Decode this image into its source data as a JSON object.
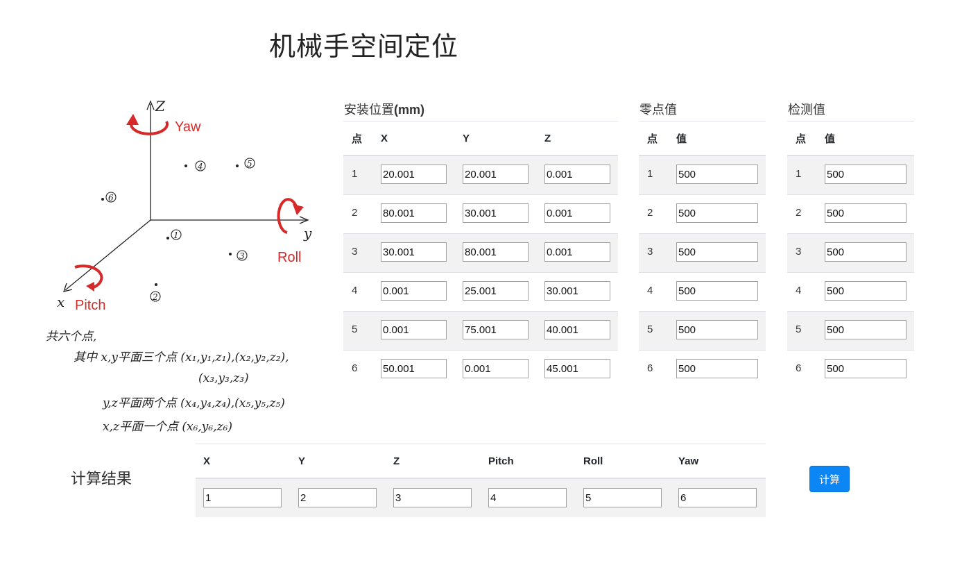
{
  "page_title": "机械手空间定位",
  "diagram": {
    "axis_z": "Z",
    "axis_y": "y",
    "axis_x": "x",
    "label_yaw": "Yaw",
    "label_roll": "Roll",
    "label_pitch": "Pitch",
    "points": [
      "1",
      "2",
      "3",
      "4",
      "5",
      "6"
    ],
    "note_line1": "共六个点,",
    "note_line2": "其中 x,y平面三个点 (x₁,y₁,z₁),(x₂,y₂,z₂),",
    "note_line3": "(x₃,y₃,z₃)",
    "note_line4": "y,z平面两个点 (x₄,y₄,z₄),(x₅,y₅,z₅)",
    "note_line5": "x,z平面一个点 (x₆,y₆,z₆)"
  },
  "position_section": {
    "title": "安装位置",
    "unit": "(mm)",
    "headers": [
      "点",
      "X",
      "Y",
      "Z"
    ],
    "rows": [
      {
        "point": "1",
        "x": "20.001",
        "y": "20.001",
        "z": "0.001"
      },
      {
        "point": "2",
        "x": "80.001",
        "y": "30.001",
        "z": "0.001"
      },
      {
        "point": "3",
        "x": "30.001",
        "y": "80.001",
        "z": "0.001"
      },
      {
        "point": "4",
        "x": "0.001",
        "y": "25.001",
        "z": "30.001"
      },
      {
        "point": "5",
        "x": "0.001",
        "y": "75.001",
        "z": "40.001"
      },
      {
        "point": "6",
        "x": "50.001",
        "y": "0.001",
        "z": "45.001"
      }
    ]
  },
  "zero_section": {
    "title": "零点值",
    "headers": [
      "点",
      "值"
    ],
    "rows": [
      {
        "point": "1",
        "value": "500"
      },
      {
        "point": "2",
        "value": "500"
      },
      {
        "point": "3",
        "value": "500"
      },
      {
        "point": "4",
        "value": "500"
      },
      {
        "point": "5",
        "value": "500"
      },
      {
        "point": "6",
        "value": "500"
      }
    ]
  },
  "detect_section": {
    "title": "检测值",
    "headers": [
      "点",
      "值"
    ],
    "rows": [
      {
        "point": "1",
        "value": "500"
      },
      {
        "point": "2",
        "value": "500"
      },
      {
        "point": "3",
        "value": "500"
      },
      {
        "point": "4",
        "value": "500"
      },
      {
        "point": "5",
        "value": "500"
      },
      {
        "point": "6",
        "value": "500"
      }
    ]
  },
  "result_section": {
    "label": "计算结果",
    "headers": [
      "X",
      "Y",
      "Z",
      "Pitch",
      "Roll",
      "Yaw"
    ],
    "values": [
      "1",
      "2",
      "3",
      "4",
      "5",
      "6"
    ]
  },
  "calc_button": "计算",
  "colors": {
    "accent_button": "#0d86f5",
    "rotation_arrows": "#d62a2a",
    "striped_row": "#f2f2f2"
  }
}
